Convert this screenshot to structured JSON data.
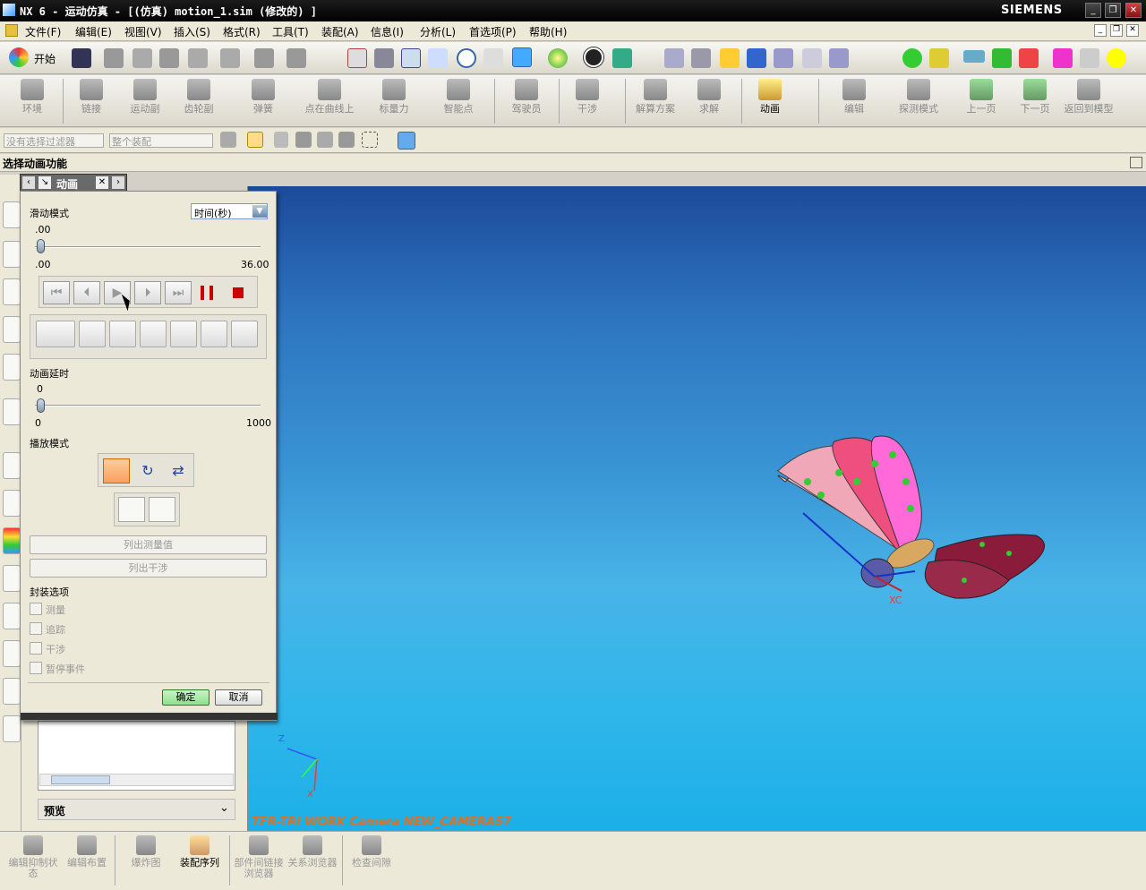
{
  "window": {
    "title": "NX 6 - 运动仿真 - [(仿真) motion_1.sim (修改的) ]",
    "brand": "SIEMENS"
  },
  "menubar": [
    "文件(F)",
    "编辑(E)",
    "视图(V)",
    "插入(S)",
    "格式(R)",
    "工具(T)",
    "装配(A)",
    "信息(I)",
    "分析(L)",
    "首选项(P)",
    "帮助(H)"
  ],
  "toolbar_start_label": "开始",
  "motion_toolbar": [
    {
      "label": "环境",
      "enabled": false
    },
    {
      "label": "链接",
      "enabled": false
    },
    {
      "label": "运动副",
      "enabled": false
    },
    {
      "label": "齿轮副",
      "enabled": false
    },
    {
      "label": "弹簧",
      "enabled": false
    },
    {
      "label": "点在曲线上",
      "enabled": false
    },
    {
      "label": "标量力",
      "enabled": false
    },
    {
      "label": "智能点",
      "enabled": false
    },
    {
      "label": "驾驶员",
      "enabled": false
    },
    {
      "label": "干涉",
      "enabled": false
    },
    {
      "label": "解算方案",
      "enabled": false
    },
    {
      "label": "求解",
      "enabled": false
    },
    {
      "label": "动画",
      "enabled": true
    },
    {
      "label": "编辑",
      "enabled": false
    },
    {
      "label": "探测模式",
      "enabled": false
    },
    {
      "label": "上一页",
      "enabled": false
    },
    {
      "label": "下一页",
      "enabled": false
    },
    {
      "label": "返回到模型",
      "enabled": false
    }
  ],
  "selection_bar": {
    "filter": "没有选择过滤器",
    "scope": "整个装配"
  },
  "prompt": "选择动画功能",
  "dialog": {
    "tab_title": "动画",
    "slide_mode_label": "滑动模式",
    "slide_mode_value": "时间(秒)",
    "time_current": ".00",
    "time_min": ".00",
    "time_max": "36.00",
    "animation_delay_label": "动画延时",
    "delay_current": "0",
    "delay_min": "0",
    "delay_max": "1000",
    "play_mode_label": "播放模式",
    "list_measure": "列出测量值",
    "list_interference": "列出干涉",
    "envelope_label": "封装选项",
    "options": [
      "测量",
      "追踪",
      "干涉",
      "暂停事件"
    ],
    "ok": "确定",
    "cancel": "取消"
  },
  "nav_panel": {
    "preview_label": "预览"
  },
  "viewport": {
    "status": "TFR-TRI WORK Camera NEW_CAMERA57",
    "axis_z": "Z",
    "axis_x": "X",
    "xc": "XC"
  },
  "bottom_toolbar": [
    {
      "label": "编辑抑制状态",
      "enabled": false
    },
    {
      "label": "编辑布置",
      "enabled": false
    },
    {
      "label": "爆炸图",
      "enabled": false
    },
    {
      "label": "装配序列",
      "enabled": true
    },
    {
      "label": "部件间链接浏览器",
      "enabled": false
    },
    {
      "label": "关系浏览器",
      "enabled": false
    },
    {
      "label": "检查间隙",
      "enabled": false
    }
  ],
  "colors": {
    "viewport_top": "#1c4a9a",
    "viewport_bottom": "#1bb0e8",
    "active_button": "#f7a060",
    "ok_button": "#8fe08f"
  }
}
